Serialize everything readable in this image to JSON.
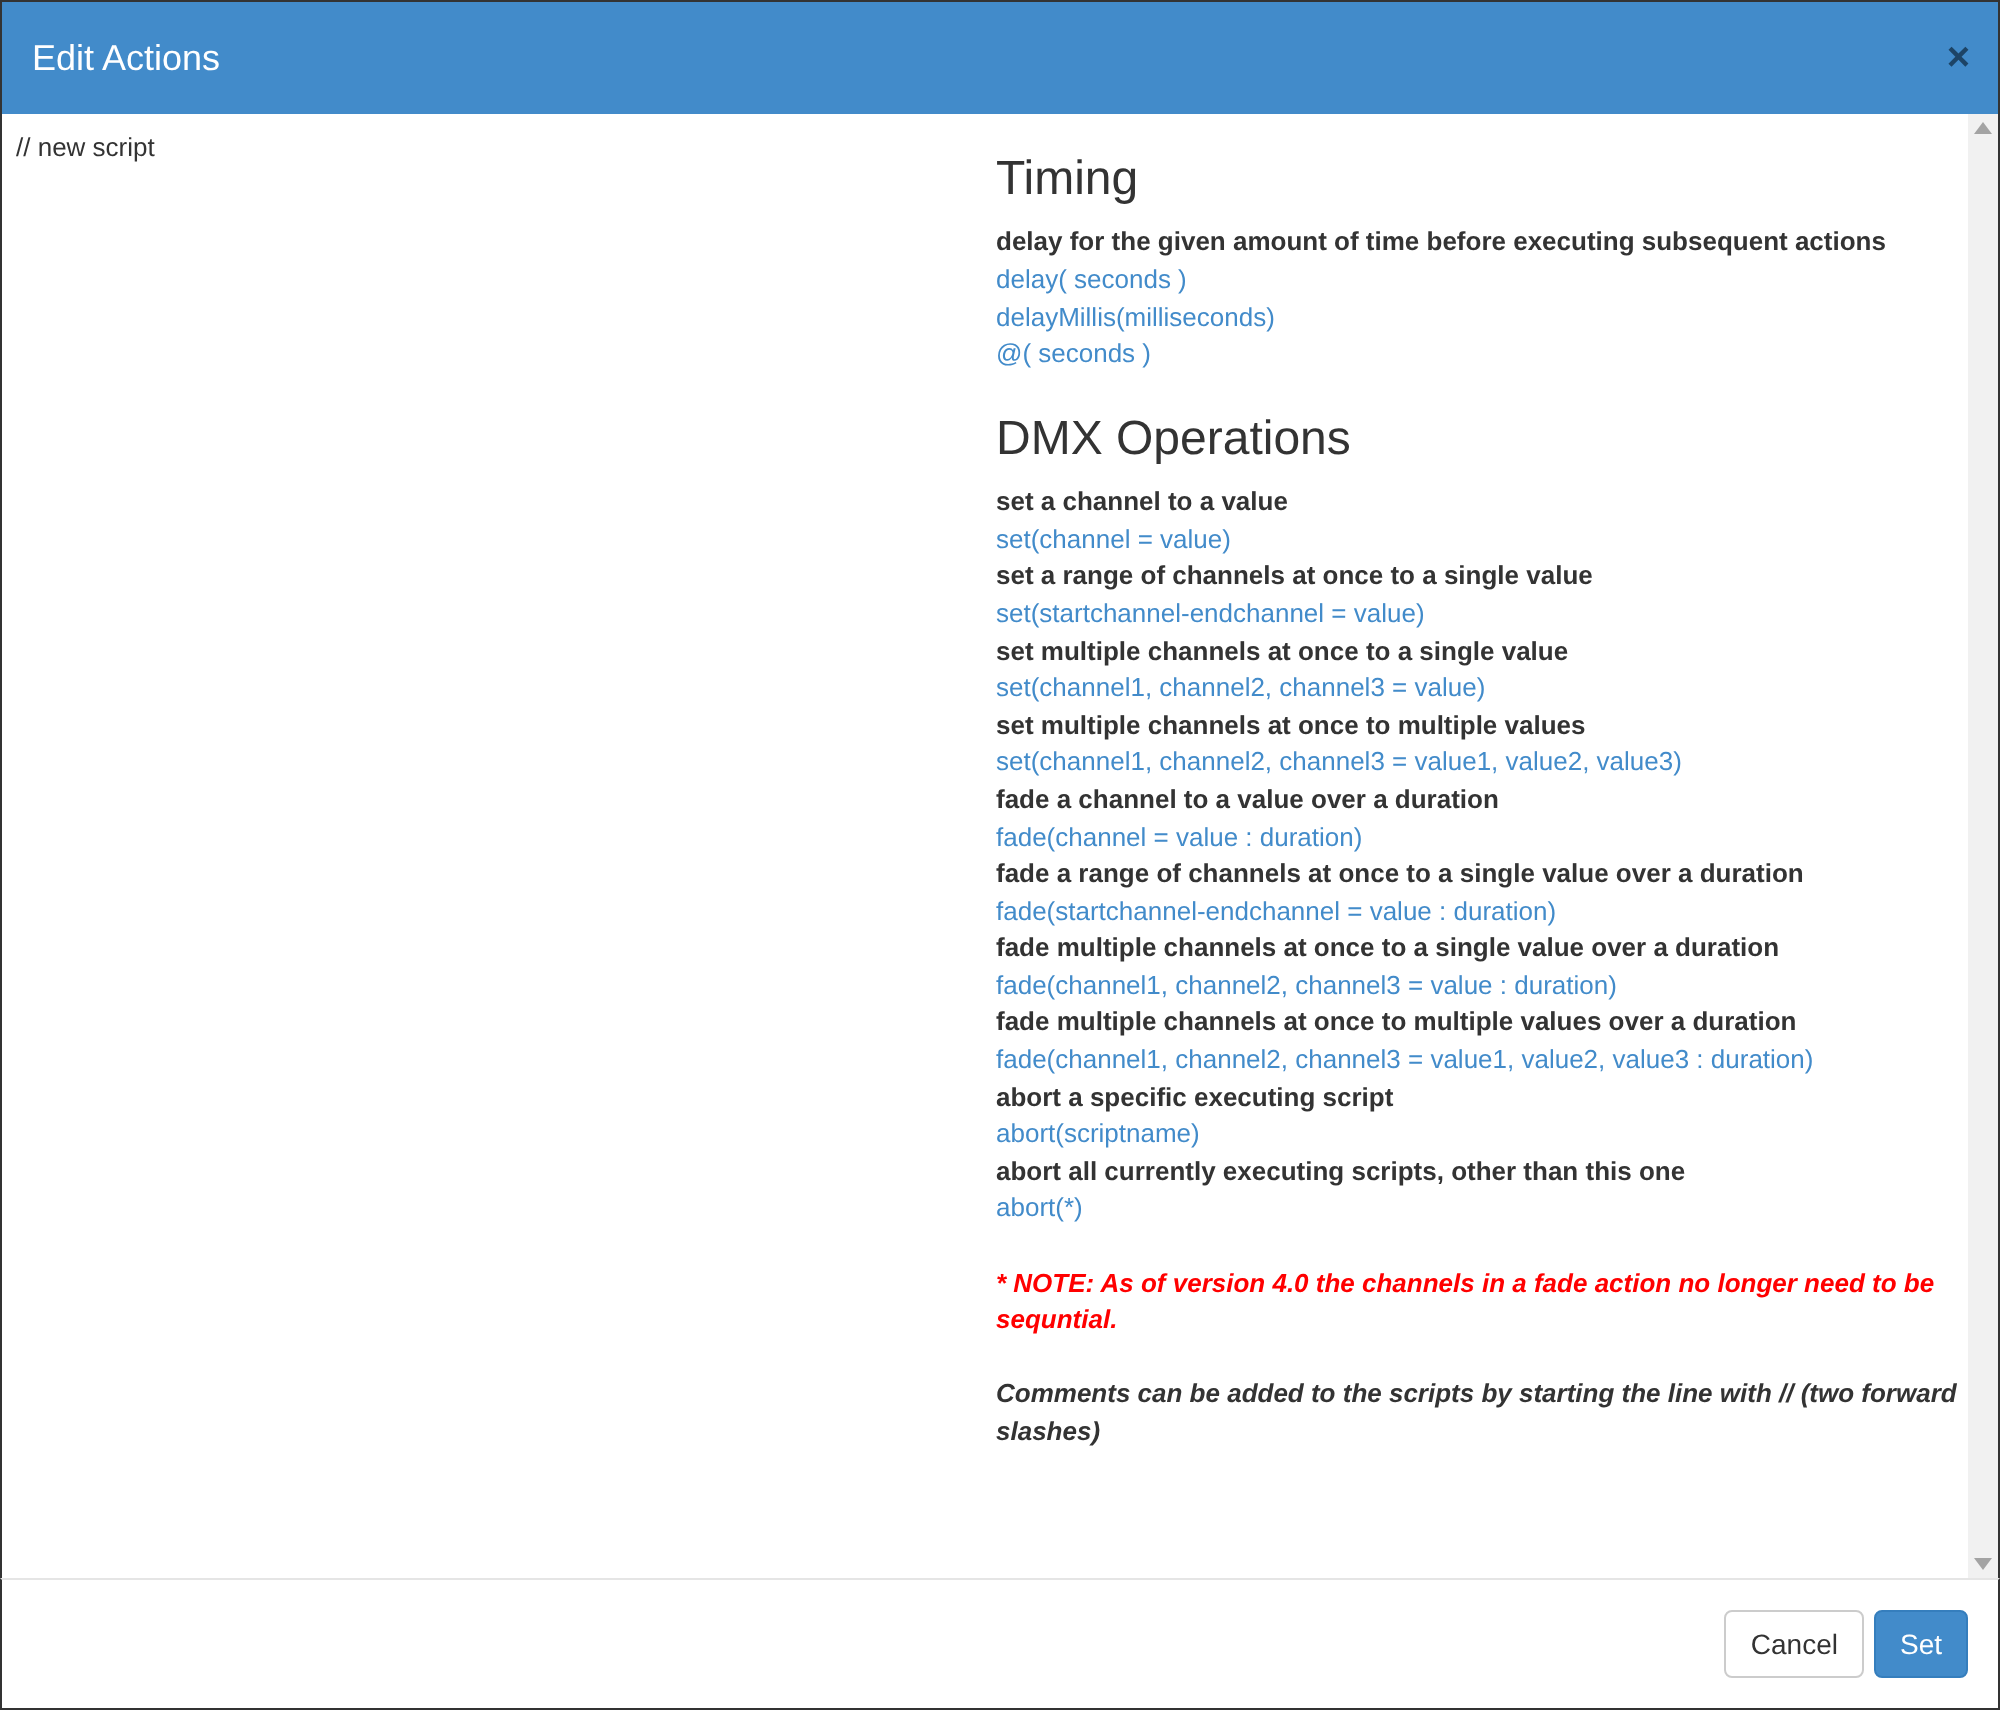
{
  "dialog": {
    "title": "Edit Actions",
    "close": "×"
  },
  "editor": {
    "value": "// new script"
  },
  "help": [
    {
      "kind": "heading",
      "text": "Timing"
    },
    {
      "kind": "desc",
      "text": "delay for the given amount of time before executing subsequent actions"
    },
    {
      "kind": "code",
      "text": "delay( seconds )"
    },
    {
      "kind": "code",
      "text": "delayMillis(milliseconds)"
    },
    {
      "kind": "code",
      "text": "@( seconds )"
    },
    {
      "kind": "heading",
      "text": "DMX Operations"
    },
    {
      "kind": "desc",
      "text": "set a channel to a value"
    },
    {
      "kind": "code",
      "text": "set(channel = value)"
    },
    {
      "kind": "desc",
      "text": "set a range of channels at once to a single value"
    },
    {
      "kind": "code",
      "text": "set(startchannel-endchannel = value)"
    },
    {
      "kind": "desc",
      "text": "set multiple channels at once to a single value"
    },
    {
      "kind": "code",
      "text": "set(channel1, channel2, channel3 = value)"
    },
    {
      "kind": "desc",
      "text": "set multiple channels at once to multiple values"
    },
    {
      "kind": "code",
      "text": "set(channel1, channel2, channel3 = value1, value2, value3)"
    },
    {
      "kind": "desc",
      "text": "fade a channel to a value over a duration"
    },
    {
      "kind": "code",
      "text": "fade(channel = value : duration)"
    },
    {
      "kind": "desc",
      "text": "fade a range of channels at once to a single value over a duration"
    },
    {
      "kind": "code",
      "text": "fade(startchannel-endchannel = value : duration)"
    },
    {
      "kind": "desc",
      "text": "fade multiple channels at once to a single value over a duration"
    },
    {
      "kind": "code",
      "text": "fade(channel1, channel2, channel3 = value : duration)"
    },
    {
      "kind": "desc",
      "text": "fade multiple channels at once to multiple values over a duration"
    },
    {
      "kind": "code",
      "text": "fade(channel1, channel2, channel3 = value1, value2, value3 : duration)"
    },
    {
      "kind": "desc",
      "text": "abort a specific executing script"
    },
    {
      "kind": "code",
      "text": "abort(scriptname)"
    },
    {
      "kind": "desc",
      "text": "abort all currently executing scripts, other than this one"
    },
    {
      "kind": "code",
      "text": "abort(*)"
    },
    {
      "kind": "note",
      "text": "* NOTE: As of version 4.0 the channels in a fade action no longer need to be sequntial."
    },
    {
      "kind": "comment",
      "text": "Comments can be added to the scripts by starting the line with // (two forward slashes)"
    }
  ],
  "buttons": [
    {
      "label": "Cancel",
      "kind": "default"
    },
    {
      "label": "Set",
      "kind": "primary"
    }
  ]
}
